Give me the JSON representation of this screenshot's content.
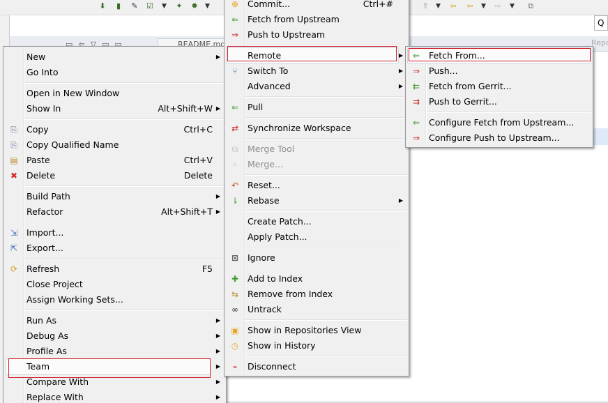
{
  "background": {
    "editor_tab": "README.md",
    "search_text": "Q",
    "right_tab": "Repositor"
  },
  "context_menu": [
    {
      "label": "New",
      "arrow": true
    },
    {
      "label": "Go Into"
    },
    {
      "label": "Open in New Window"
    },
    {
      "label": "Show In",
      "shortcut": "Alt+Shift+W",
      "arrow": true
    },
    {
      "label": "Copy",
      "shortcut": "Ctrl+C",
      "icon": "copy-icon"
    },
    {
      "label": "Copy Qualified Name",
      "icon": "copy-qualified-name-icon"
    },
    {
      "label": "Paste",
      "shortcut": "Ctrl+V",
      "icon": "paste-icon"
    },
    {
      "label": "Delete",
      "shortcut": "Delete",
      "icon": "delete-icon"
    },
    {
      "label": "Build Path",
      "arrow": true
    },
    {
      "label": "Refactor",
      "shortcut": "Alt+Shift+T",
      "arrow": true
    },
    {
      "label": "Import...",
      "icon": "import-icon"
    },
    {
      "label": "Export...",
      "icon": "export-icon"
    },
    {
      "label": "Refresh",
      "shortcut": "F5",
      "icon": "refresh-icon"
    },
    {
      "label": "Close Project"
    },
    {
      "label": "Assign Working Sets..."
    },
    {
      "label": "Run As",
      "arrow": true
    },
    {
      "label": "Debug As",
      "arrow": true
    },
    {
      "label": "Profile As",
      "arrow": true
    },
    {
      "label": "Team",
      "arrow": true,
      "active": true
    },
    {
      "label": "Compare With",
      "arrow": true
    },
    {
      "label": "Replace With",
      "arrow": true
    }
  ],
  "team_menu": [
    {
      "label": "Commit...",
      "shortcut": "Ctrl+#",
      "icon": "commit-icon"
    },
    {
      "label": "Fetch from Upstream",
      "icon": "fetch-upstream-icon"
    },
    {
      "label": "Push to Upstream",
      "icon": "push-upstream-icon"
    },
    {
      "label": "Remote",
      "arrow": true,
      "active": true
    },
    {
      "label": "Switch To",
      "arrow": true,
      "icon": "switch-branch-icon"
    },
    {
      "label": "Advanced",
      "arrow": true
    },
    {
      "label": "Pull",
      "icon": "pull-icon"
    },
    {
      "label": "Synchronize Workspace",
      "icon": "synchronize-icon"
    },
    {
      "label": "Merge Tool",
      "disabled": true,
      "icon": "merge-tool-icon"
    },
    {
      "label": "Merge...",
      "disabled": true,
      "icon": "merge-icon"
    },
    {
      "label": "Reset...",
      "icon": "reset-icon"
    },
    {
      "label": "Rebase",
      "arrow": true,
      "icon": "rebase-icon"
    },
    {
      "label": "Create Patch..."
    },
    {
      "label": "Apply Patch..."
    },
    {
      "label": "Ignore",
      "icon": "ignore-icon"
    },
    {
      "label": "Add to Index",
      "icon": "add-to-index-icon"
    },
    {
      "label": "Remove from Index",
      "icon": "remove-from-index-icon"
    },
    {
      "label": "Untrack",
      "icon": "untrack-icon"
    },
    {
      "label": "Show in Repositories View",
      "icon": "repositories-view-icon"
    },
    {
      "label": "Show in History",
      "icon": "history-icon"
    },
    {
      "label": "Disconnect",
      "icon": "disconnect-icon"
    }
  ],
  "remote_menu": [
    {
      "label": "Fetch From...",
      "icon": "fetch-from-icon",
      "active": true
    },
    {
      "label": "Push...",
      "icon": "push-icon"
    },
    {
      "label": "Fetch from Gerrit...",
      "icon": "fetch-gerrit-icon"
    },
    {
      "label": "Push to Gerrit...",
      "icon": "push-gerrit-icon"
    },
    {
      "label": "Configure Fetch from Upstream...",
      "icon": "configure-fetch-icon"
    },
    {
      "label": "Configure Push to Upstream...",
      "icon": "configure-push-icon"
    }
  ],
  "colors": {
    "highlight_border": "#d21f2a",
    "menu_bg": "#f0f0f0",
    "git_orange": "#e8a628",
    "git_green": "#3f9b2f",
    "git_red": "#cc2a2a"
  }
}
